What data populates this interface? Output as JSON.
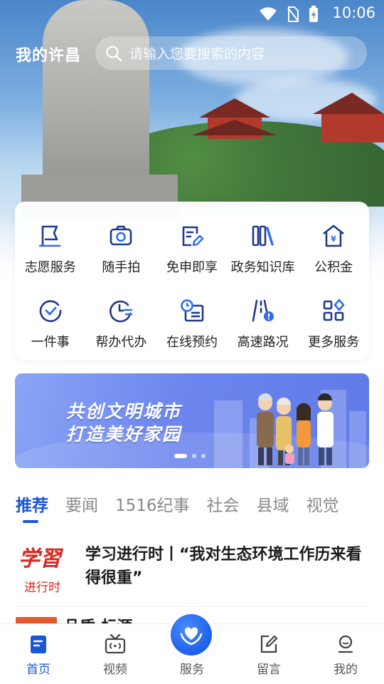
{
  "status_bar": {
    "time": "10:06"
  },
  "header": {
    "city": "我的许昌",
    "search_placeholder": "请输入您要搜索的内容"
  },
  "services": {
    "row1": [
      {
        "label": "志愿服务",
        "icon": "flag-icon"
      },
      {
        "label": "随手拍",
        "icon": "camera-icon"
      },
      {
        "label": "免申即享",
        "icon": "form-edit-icon"
      },
      {
        "label": "政务知识库",
        "icon": "books-icon"
      },
      {
        "label": "公积金",
        "icon": "house-yuan-icon"
      }
    ],
    "row2": [
      {
        "label": "一件事",
        "icon": "check-circle-icon"
      },
      {
        "label": "帮办代办",
        "icon": "clock-list-icon"
      },
      {
        "label": "在线预约",
        "icon": "calendar-clock-icon"
      },
      {
        "label": "高速路况",
        "icon": "road-alert-icon"
      },
      {
        "label": "更多服务",
        "icon": "grid-more-icon"
      }
    ]
  },
  "banner": {
    "line1": "共创文明城市",
    "line2": "打造美好家园",
    "slide_index": 1,
    "slide_count": 3
  },
  "tabs": [
    "推荐",
    "要闻",
    "1516纪事",
    "社会",
    "县域",
    "视觉"
  ],
  "active_tab": "推荐",
  "news": [
    {
      "logo_top": "学習",
      "logo_bottom": "进行时",
      "title": "学习进行时丨“我对生态环境工作历来看得很重”"
    },
    {
      "title": "品质·标源"
    }
  ],
  "bottom_nav": [
    "首页",
    "视频",
    "服务",
    "留言",
    "我的"
  ],
  "colors": {
    "accent": "#1a56d8",
    "logo_red": "#d6281e"
  }
}
